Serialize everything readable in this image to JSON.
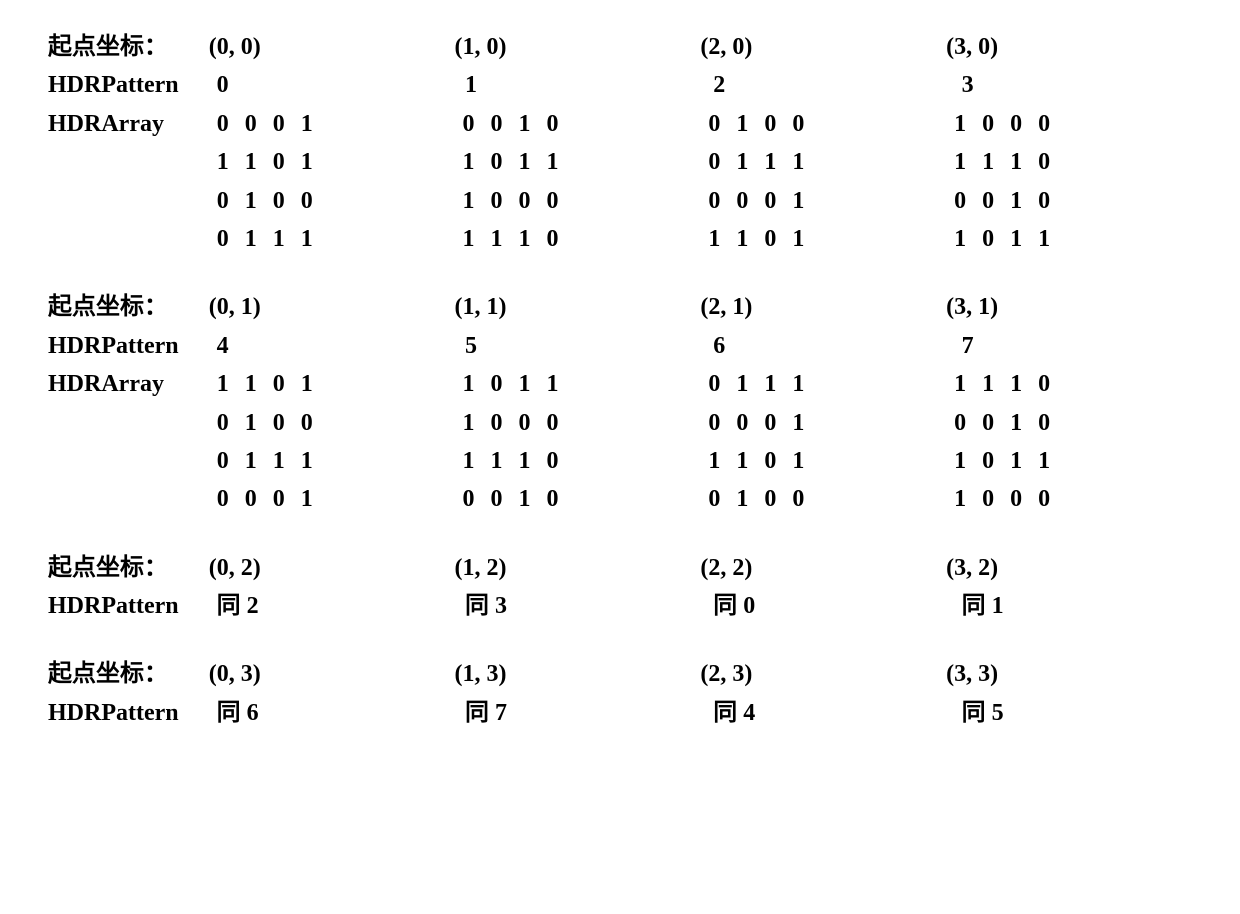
{
  "labels": {
    "coord": "起点坐标：",
    "pattern": "HDRPattern",
    "array": "HDRArray"
  },
  "sections": [
    {
      "hasArray": true,
      "entries": [
        {
          "coord": "(0, 0)",
          "pattern": "0",
          "array": [
            [
              "0",
              "0",
              "0",
              "1"
            ],
            [
              "1",
              "1",
              "0",
              "1"
            ],
            [
              "0",
              "1",
              "0",
              "0"
            ],
            [
              "0",
              "1",
              "1",
              "1"
            ]
          ]
        },
        {
          "coord": "(1, 0)",
          "pattern": "1",
          "array": [
            [
              "0",
              "0",
              "1",
              "0"
            ],
            [
              "1",
              "0",
              "1",
              "1"
            ],
            [
              "1",
              "0",
              "0",
              "0"
            ],
            [
              "1",
              "1",
              "1",
              "0"
            ]
          ]
        },
        {
          "coord": "(2, 0)",
          "pattern": "2",
          "array": [
            [
              "0",
              "1",
              "0",
              "0"
            ],
            [
              "0",
              "1",
              "1",
              "1"
            ],
            [
              "0",
              "0",
              "0",
              "1"
            ],
            [
              "1",
              "1",
              "0",
              "1"
            ]
          ]
        },
        {
          "coord": "(3, 0)",
          "pattern": "3",
          "array": [
            [
              "1",
              "0",
              "0",
              "0"
            ],
            [
              "1",
              "1",
              "1",
              "0"
            ],
            [
              "0",
              "0",
              "1",
              "0"
            ],
            [
              "1",
              "0",
              "1",
              "1"
            ]
          ]
        }
      ]
    },
    {
      "hasArray": true,
      "entries": [
        {
          "coord": "(0, 1)",
          "pattern": "4",
          "array": [
            [
              "1",
              "1",
              "0",
              "1"
            ],
            [
              "0",
              "1",
              "0",
              "0"
            ],
            [
              "0",
              "1",
              "1",
              "1"
            ],
            [
              "0",
              "0",
              "0",
              "1"
            ]
          ]
        },
        {
          "coord": "(1, 1)",
          "pattern": "5",
          "array": [
            [
              "1",
              "0",
              "1",
              "1"
            ],
            [
              "1",
              "0",
              "0",
              "0"
            ],
            [
              "1",
              "1",
              "1",
              "0"
            ],
            [
              "0",
              "0",
              "1",
              "0"
            ]
          ]
        },
        {
          "coord": "(2, 1)",
          "pattern": "6",
          "array": [
            [
              "0",
              "1",
              "1",
              "1"
            ],
            [
              "0",
              "0",
              "0",
              "1"
            ],
            [
              "1",
              "1",
              "0",
              "1"
            ],
            [
              "0",
              "1",
              "0",
              "0"
            ]
          ]
        },
        {
          "coord": "(3, 1)",
          "pattern": "7",
          "array": [
            [
              "1",
              "1",
              "1",
              "0"
            ],
            [
              "0",
              "0",
              "1",
              "0"
            ],
            [
              "1",
              "0",
              "1",
              "1"
            ],
            [
              "1",
              "0",
              "0",
              "0"
            ]
          ]
        }
      ]
    },
    {
      "hasArray": false,
      "entries": [
        {
          "coord": "(0, 2)",
          "pattern": "同 2"
        },
        {
          "coord": "(1, 2)",
          "pattern": "同 3"
        },
        {
          "coord": "(2, 2)",
          "pattern": "同 0"
        },
        {
          "coord": "(3, 2)",
          "pattern": "同 1"
        }
      ]
    },
    {
      "hasArray": false,
      "entries": [
        {
          "coord": "(0, 3)",
          "pattern": "同 6"
        },
        {
          "coord": "(1, 3)",
          "pattern": "同 7"
        },
        {
          "coord": "(2, 3)",
          "pattern": "同 4"
        },
        {
          "coord": "(3, 3)",
          "pattern": "同 5"
        }
      ]
    }
  ]
}
